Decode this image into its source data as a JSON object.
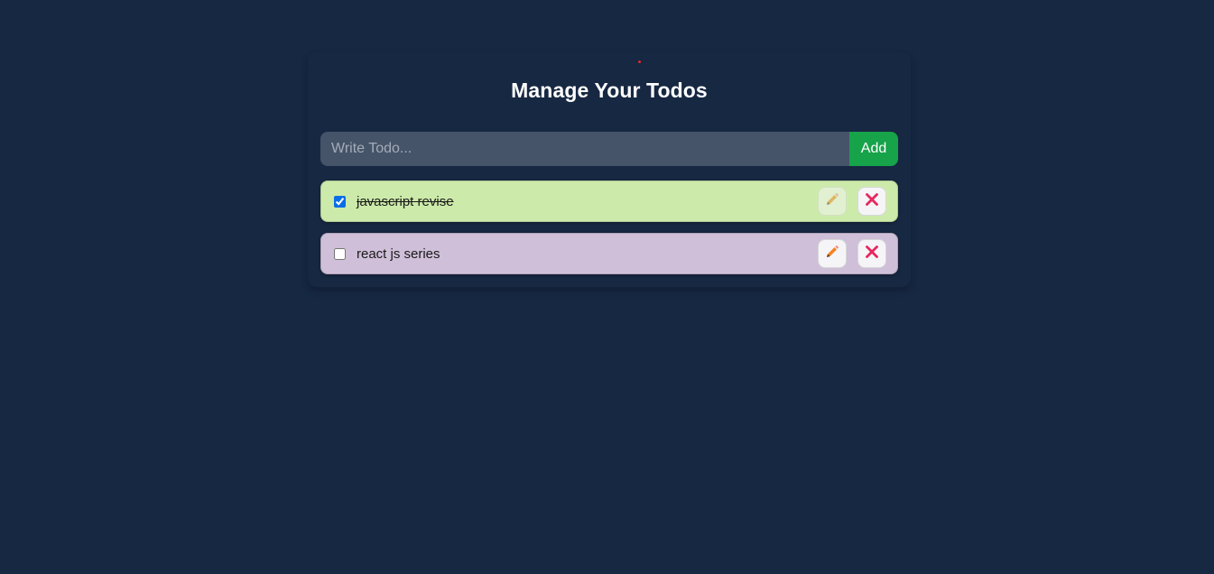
{
  "app": {
    "title": "Manage Your Todos"
  },
  "form": {
    "placeholder": "Write Todo...",
    "add_label": "Add"
  },
  "todos": [
    {
      "text": "javascript revise",
      "completed": true,
      "bg_color": "#ccebaa",
      "edit_icon": "pencil-icon",
      "delete_icon": "close-icon"
    },
    {
      "text": "react js series",
      "completed": false,
      "bg_color": "#cfbfd8",
      "edit_icon": "pencil-icon",
      "delete_icon": "close-icon"
    }
  ],
  "colors": {
    "background": "#172842",
    "accent_add": "#16a34a",
    "pencil": "#f5821f",
    "delete": "#e8265e"
  }
}
